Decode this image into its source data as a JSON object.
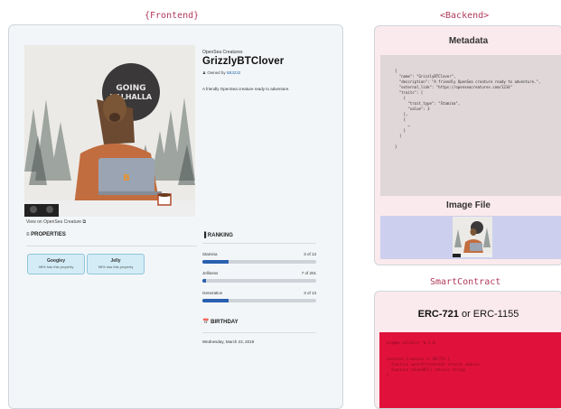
{
  "frontend": {
    "section_label": "{Frontend}",
    "view_link": "View on OpenSea Creature ⧉",
    "collection": "OpenSea Creatures",
    "name": "GrizzlyBTClover",
    "owned_by": "Owned by",
    "owner": "5B3232",
    "description": "A friendly OpenSea creature ready to adventure.",
    "image_sign": "GOING VALHALLA",
    "properties": {
      "heading": "≡ PROPERTIES",
      "items": [
        {
          "value": "Googley",
          "rarity": "98% has this property"
        },
        {
          "value": "Jelly",
          "rarity": "98% has this property"
        }
      ]
    },
    "ranking": {
      "heading": "▐ RANKING",
      "items": [
        {
          "label": "Stamina",
          "count": "3 of 13",
          "fraction": 0.23
        },
        {
          "label": "Jelliness",
          "count": "7 of 201",
          "fraction": 0.035
        },
        {
          "label": "Generation",
          "count": "3 of 13",
          "fraction": 0.23
        }
      ]
    },
    "birthday": {
      "heading": "📅 BIRTHDAY",
      "date": "Wednesday, March 23, 2018"
    }
  },
  "backend": {
    "section_label": "<Backend>",
    "metadata_title": "Metadata",
    "metadata_code": "{\n  \"name\": \"GrizzlyBTClover\",\n  \"description\": \"A friendly OpenSea creature ready to adventure.\",\n  \"external_link\": \"https://openseacreatures.com/1234\"\n  \"traits\": [\n    {\n      \"trait_type\": \"Stamina\",\n      \"value\": 3\n    },\n    {\n      …\n    }\n  ]\n\n}",
    "image_file_title": "Image File"
  },
  "smart_contract": {
    "section_label": "SmartContract",
    "title_primary": "ERC-721",
    "title_or": " or ",
    "title_secondary": "ERC-1155",
    "code": "pragma solidity ^0.5.0;\n\n\ncontract Creature is ERC721 {\n  function ownerOf(tokenId) returns address\n  function tokenURI() returns string\n}"
  },
  "colors": {
    "frontend_bg": "#f3f6f8",
    "backend_panel_bg": "#fbeaed",
    "metadata_box": "#dfd7d8",
    "image_box": "#ccd0ee",
    "contract_code_bg": "#e0123b",
    "property_card": "#d3ecf6",
    "rank_fill": "#2a60b0",
    "label_accent": "#b03a5b"
  }
}
